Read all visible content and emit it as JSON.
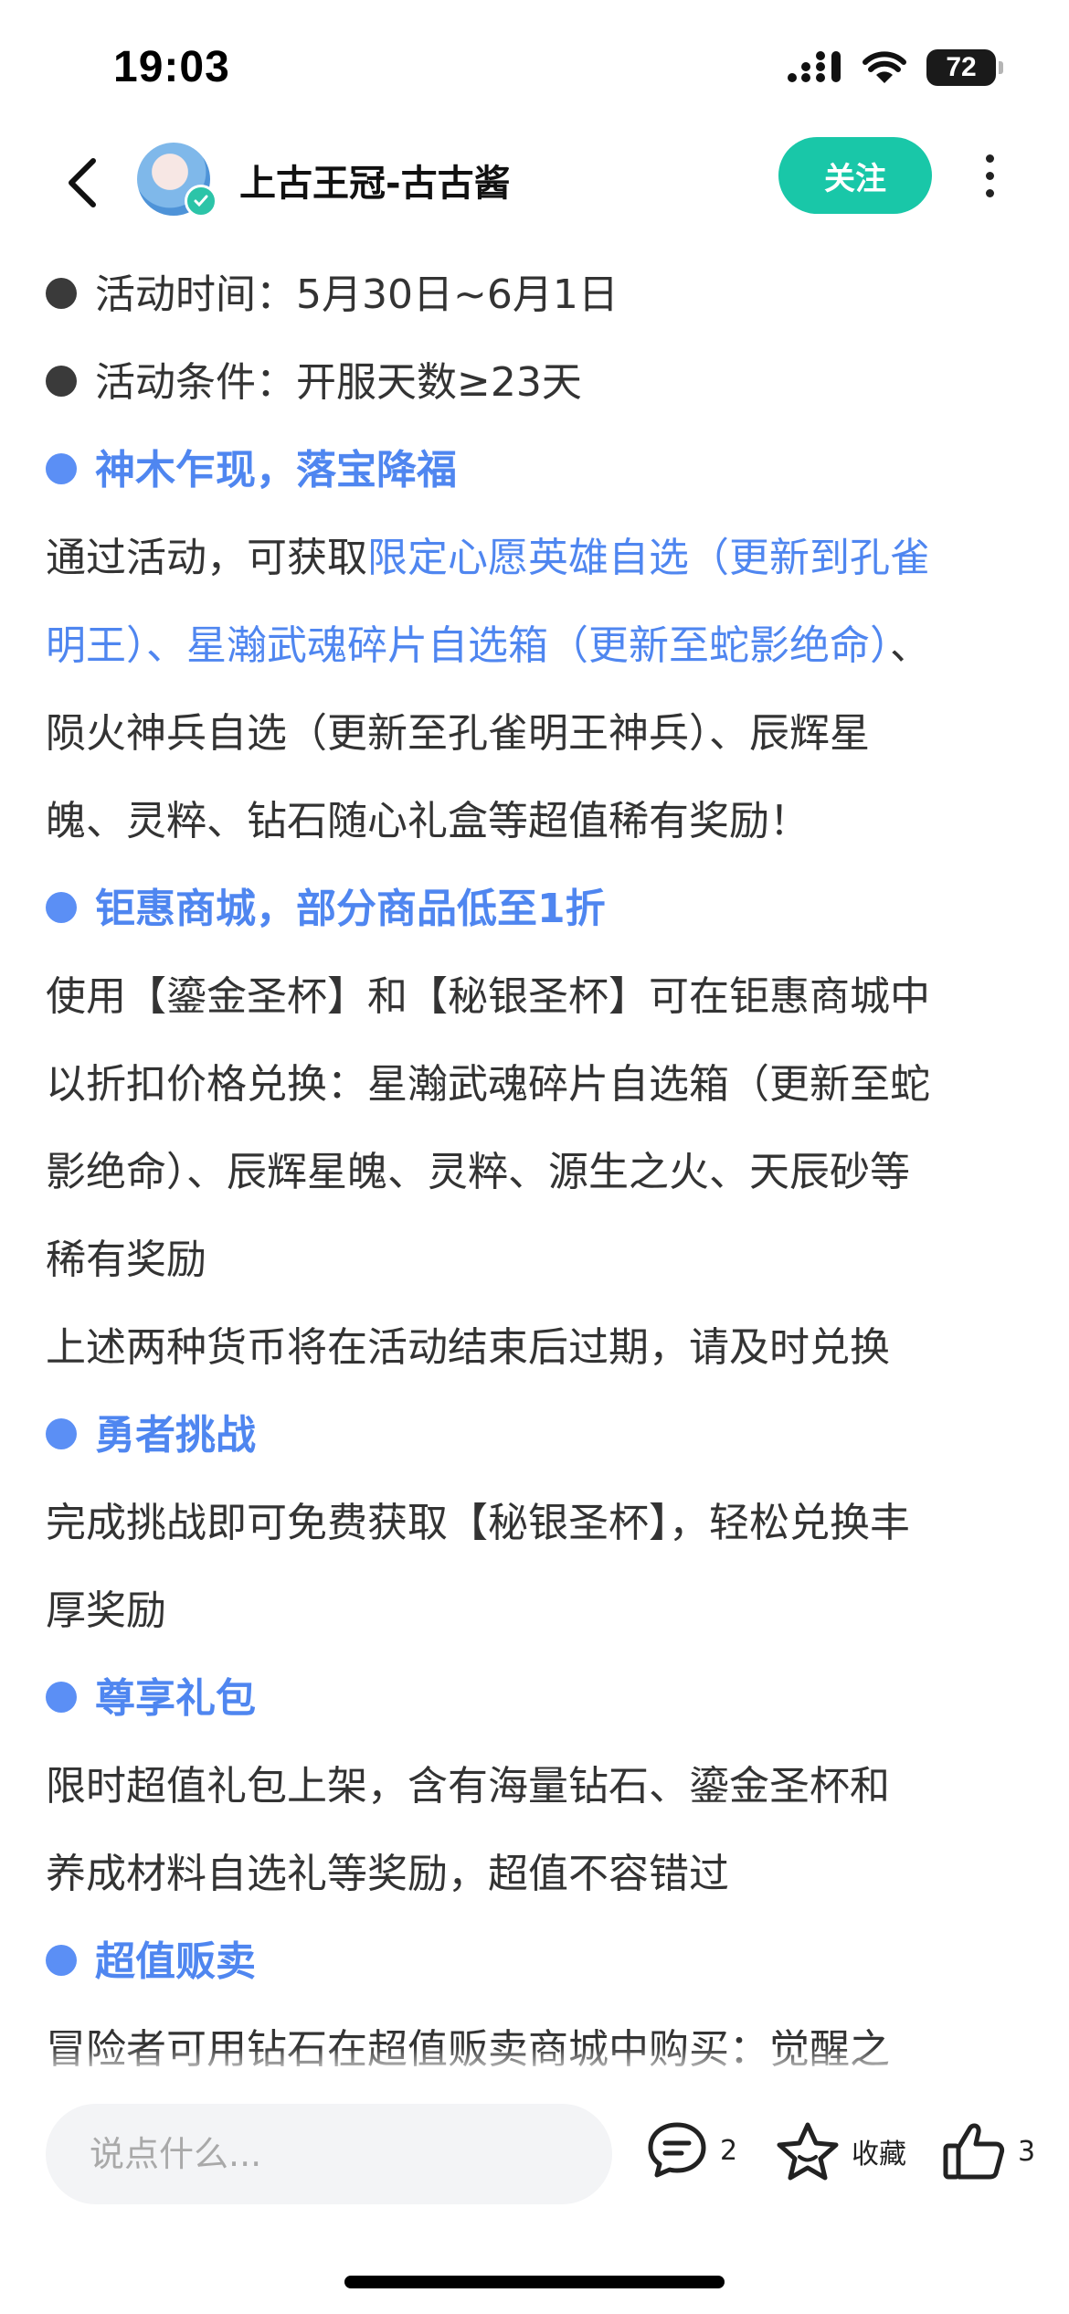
{
  "status_bar": {
    "time": "19:03",
    "battery": "72"
  },
  "header": {
    "author_name": "上古王冠-古古酱",
    "follow_label": "关注"
  },
  "article": {
    "lines": [
      {
        "type": "bullet-gray",
        "text": "活动时间：5月30日~6月1日"
      },
      {
        "type": "bullet-gray",
        "text": "活动条件：开服天数≥23天"
      },
      {
        "type": "section",
        "text": "神木乍现，落宝降福"
      },
      {
        "type": "mixed",
        "segments": [
          {
            "text": "通过活动，可获取",
            "link": false
          },
          {
            "text": "限定心愿英雄自选（更新到孔雀",
            "link": true
          }
        ]
      },
      {
        "type": "mixed",
        "segments": [
          {
            "text": "明王）、星瀚武魂碎片自选箱（更新至蛇影绝命）",
            "link": true
          },
          {
            "text": "、",
            "link": false
          }
        ]
      },
      {
        "type": "text",
        "text": "陨火神兵自选（更新至孔雀明王神兵）、辰辉星"
      },
      {
        "type": "text",
        "text": "魄、灵粹、钻石随心礼盒等超值稀有奖励！"
      },
      {
        "type": "section",
        "text": "钜惠商城，部分商品低至1折"
      },
      {
        "type": "text",
        "text": "使用【鎏金圣杯】和【秘银圣杯】可在钜惠商城中"
      },
      {
        "type": "text",
        "text": "以折扣价格兑换：星瀚武魂碎片自选箱（更新至蛇"
      },
      {
        "type": "text",
        "text": "影绝命）、辰辉星魄、灵粹、源生之火、天辰砂等"
      },
      {
        "type": "text",
        "text": "稀有奖励"
      },
      {
        "type": "text",
        "text": "上述两种货币将在活动结束后过期，请及时兑换"
      },
      {
        "type": "section",
        "text": "勇者挑战"
      },
      {
        "type": "text",
        "text": "完成挑战即可免费获取【秘银圣杯】，轻松兑换丰"
      },
      {
        "type": "text",
        "text": "厚奖励"
      },
      {
        "type": "section",
        "text": "尊享礼包"
      },
      {
        "type": "text",
        "text": "限时超值礼包上架，含有海量钻石、鎏金圣杯和"
      },
      {
        "type": "text",
        "text": "养成材料自选礼等奖励，超值不容错过"
      },
      {
        "type": "section",
        "text": "超值贩卖"
      },
      {
        "type": "text",
        "text": "冒险者可用钻石在超值贩卖商城中购买：觉醒之"
      }
    ]
  },
  "bottom_bar": {
    "comment_placeholder": "说点什么...",
    "comment_count": "2",
    "favorite_label": "收藏",
    "like_count": "3"
  },
  "colors": {
    "accent": "#19c7a8",
    "link": "#4f86f0",
    "text": "#333333"
  }
}
